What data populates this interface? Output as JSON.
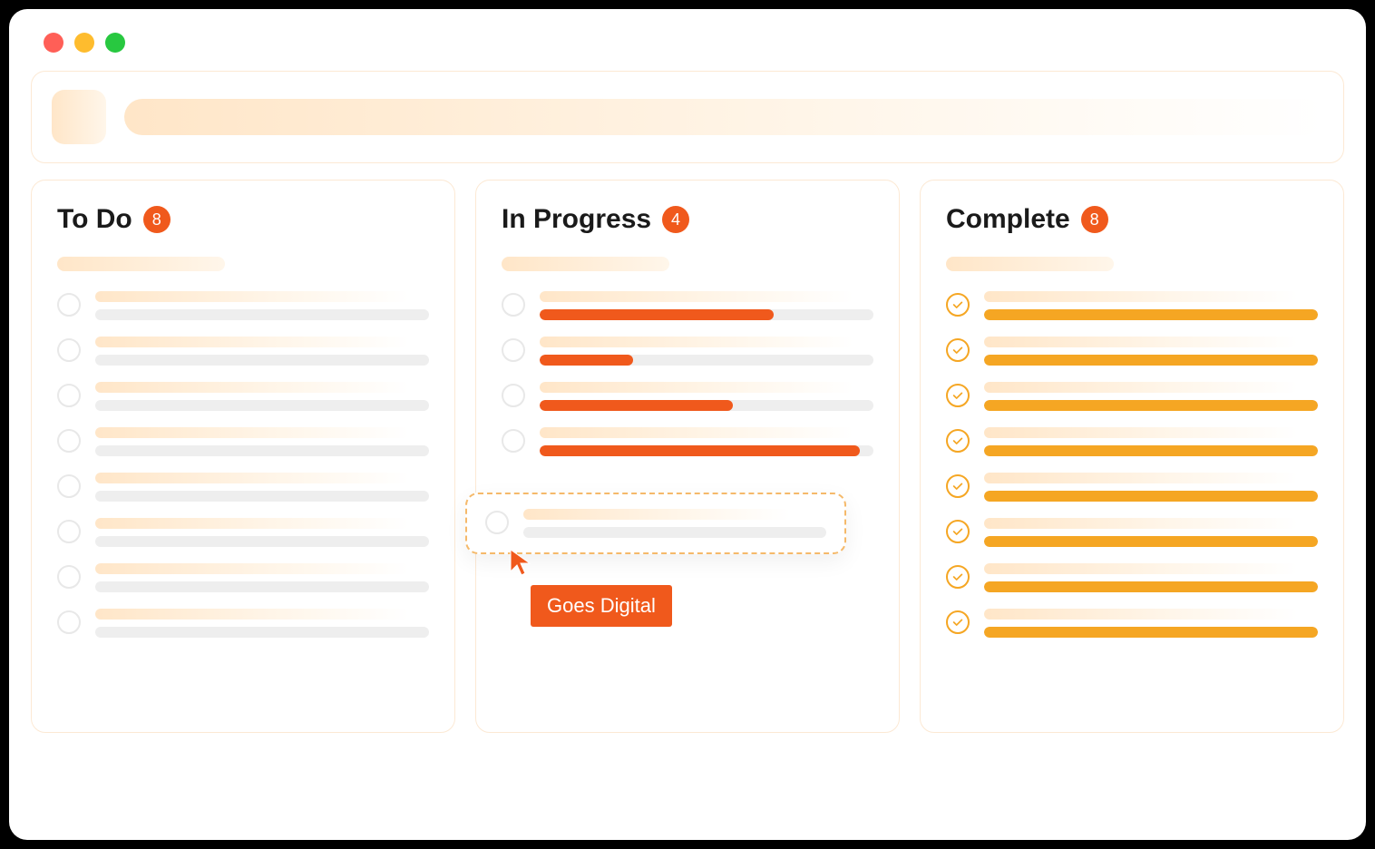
{
  "colors": {
    "accent_orange": "#f0591c",
    "accent_amber": "#f5a623",
    "border_soft": "#fce9d4"
  },
  "columns": {
    "todo": {
      "title": "To Do",
      "count": "8",
      "items": 8
    },
    "in_progress": {
      "title": "In Progress",
      "count": "4",
      "progress": [
        70,
        28,
        58,
        96
      ]
    },
    "complete": {
      "title": "Complete",
      "count": "8",
      "items": 8
    }
  },
  "drag": {
    "tooltip": "Goes Digital"
  }
}
